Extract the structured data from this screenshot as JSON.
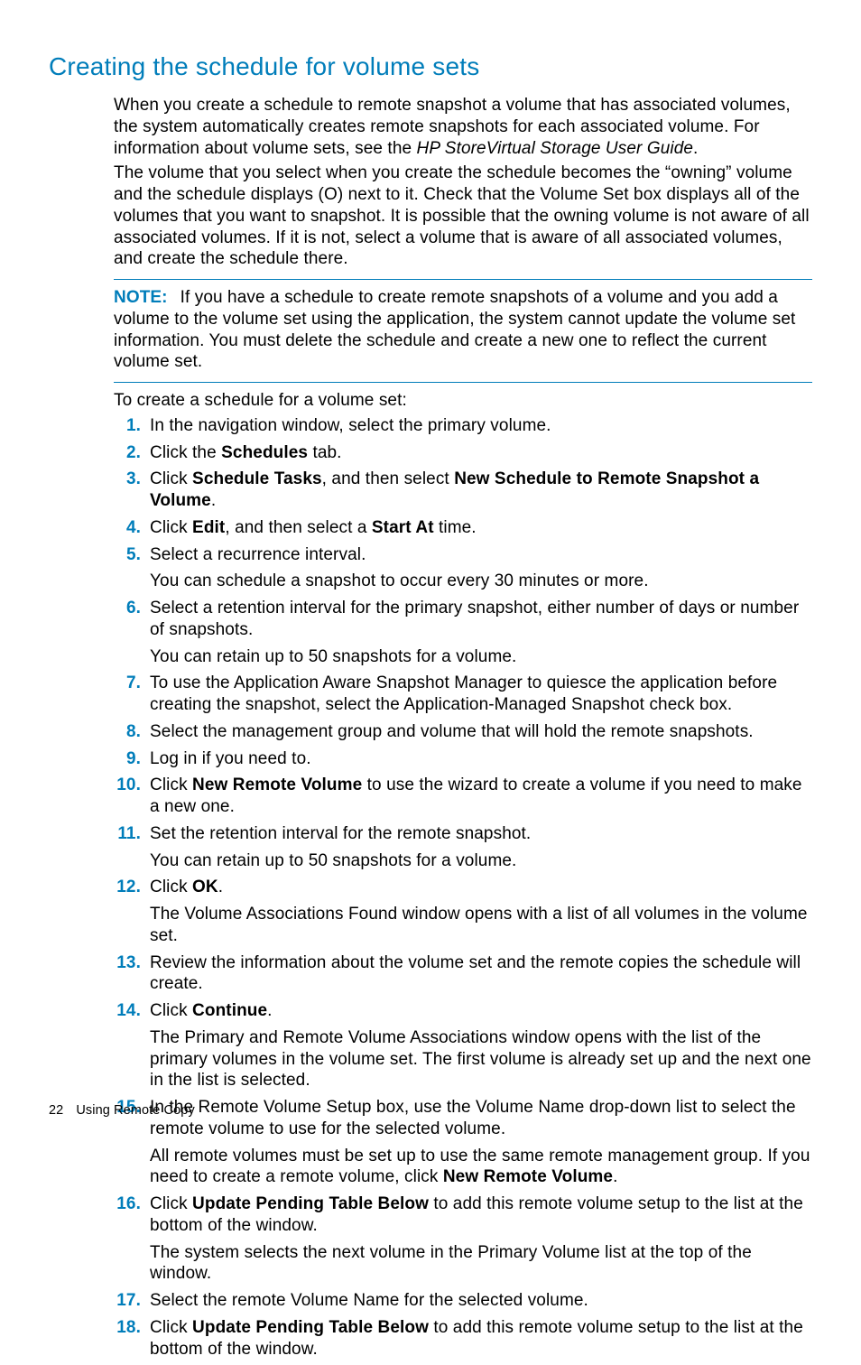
{
  "title": "Creating the schedule for volume sets",
  "intro1a": "When you create a schedule to remote snapshot a volume that has associated volumes, the system automatically creates remote snapshots for each associated volume. For information about volume sets, see the ",
  "intro1_book": "HP StoreVirtual Storage User Guide",
  "intro1b": ".",
  "intro2": "The volume that you select when you create the schedule becomes the “owning” volume and the schedule displays (O) next to it. Check that the Volume Set box displays all of the volumes that you want to snapshot. It is possible that the owning volume is not aware of all associated volumes. If it is not, select a volume that is aware of all associated volumes, and create the schedule there.",
  "note_label": "NOTE:",
  "note_body": "If you have a schedule to create remote snapshots of a volume and you add a volume to the volume set using the application, the system cannot update the volume set information. You must delete the schedule and create a new one to reflect the current volume set.",
  "lead_in": "To create a schedule for a volume set:",
  "s1": "In the navigation window, select the primary volume.",
  "s2a": "Click the ",
  "s2b": "Schedules",
  "s2c": " tab.",
  "s3a": "Click ",
  "s3b": "Schedule Tasks",
  "s3c": ", and then select ",
  "s3d": "New Schedule to Remote Snapshot a Volume",
  "s3e": ".",
  "s4a": "Click ",
  "s4b": "Edit",
  "s4c": ", and then select a ",
  "s4d": "Start At",
  "s4e": " time.",
  "s5": "Select a recurrence interval.",
  "s5_sub": "You can schedule a snapshot to occur every 30 minutes or more.",
  "s6": "Select a retention interval for the primary snapshot, either number of days or number of snapshots.",
  "s6_sub": "You can retain up to 50 snapshots for a volume.",
  "s7": "To use the Application Aware Snapshot Manager to quiesce the application before creating the snapshot, select the Application-Managed Snapshot check box.",
  "s8": "Select the management group and volume that will hold the remote snapshots.",
  "s9": "Log in if you need to.",
  "s10a": "Click ",
  "s10b": "New Remote Volume",
  "s10c": " to use the wizard to create a volume if you need to make a new one.",
  "s11": "Set the retention interval for the remote snapshot.",
  "s11_sub": "You can retain up to 50 snapshots for a volume.",
  "s12a": "Click ",
  "s12b": "OK",
  "s12c": ".",
  "s12_sub": "The Volume Associations Found window opens with a list of all volumes in the volume set.",
  "s13": "Review the information about the volume set and the remote copies the schedule will create.",
  "s14a": "Click ",
  "s14b": "Continue",
  "s14c": ".",
  "s14_sub": "The Primary and Remote Volume Associations window opens with the list of the primary volumes in the volume set. The first volume is already set up and the next one in the list is selected.",
  "s15": "In the Remote Volume Setup box, use the Volume Name drop-down list to select the remote volume to use for the selected volume.",
  "s15_sub_a": "All remote volumes must be set up to use the same remote management group. If you need to create a remote volume, click ",
  "s15_sub_b": "New Remote Volume",
  "s15_sub_c": ".",
  "s16a": "Click ",
  "s16b": "Update Pending Table Below",
  "s16c": " to add this remote volume setup to the list at the bottom of the window.",
  "s16_sub": "The system selects the next volume in the Primary Volume list at the top of the window.",
  "s17": "Select the remote Volume Name for the selected volume.",
  "s18a": "Click ",
  "s18b": "Update Pending Table Below",
  "s18c": " to add this remote volume setup to the list at the bottom of the window.",
  "footer_page": "22",
  "footer_title": "Using Remote Copy"
}
